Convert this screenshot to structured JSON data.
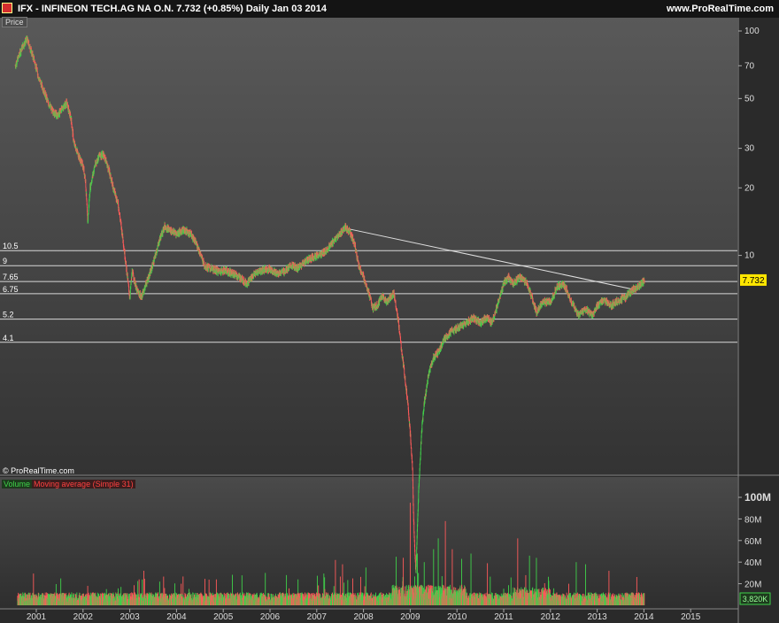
{
  "header": {
    "title": "IFX - INFINEON TECH.AG NA O.N.    7.732 (+0.85%)    Daily  Jan 03 2014",
    "site": "www.ProRealTime.com"
  },
  "price_panel_label": "Price",
  "copyright": "© ProRealTime.com",
  "volume_panel": {
    "legend_volume": "Volume",
    "legend_ma": "Moving average (Simple 31)"
  },
  "colors": {
    "up": "#3fd14a",
    "down": "#ff5a5a",
    "level_line": "#d8d8d8",
    "price_tag": "#ffe600"
  },
  "chart_data": [
    {
      "type": "line",
      "title": "IFX - INFINEON TECH.AG NA O.N.",
      "ylabel": "Price",
      "y_scale": "log",
      "ylim": [
        2.5,
        120
      ],
      "xlim": [
        2000.5,
        2015.6
      ],
      "x_ticks": [
        "2001",
        "2002",
        "2003",
        "2004",
        "2005",
        "2006",
        "2007",
        "2008",
        "2009",
        "2010",
        "2011",
        "2012",
        "2013",
        "2014",
        "2015"
      ],
      "y_ticks": [
        10,
        20,
        30,
        50,
        70,
        100
      ],
      "last_price": "7.732",
      "last_change": "+0.85%",
      "grid": false,
      "series": [
        {
          "values": [
            [
              2000.55,
              70
            ],
            [
              2000.7,
              85
            ],
            [
              2000.8,
              92
            ],
            [
              2000.95,
              75
            ],
            [
              2001.05,
              62
            ],
            [
              2001.15,
              55
            ],
            [
              2001.25,
              48
            ],
            [
              2001.35,
              44
            ],
            [
              2001.45,
              42
            ],
            [
              2001.55,
              45
            ],
            [
              2001.65,
              48
            ],
            [
              2001.75,
              40
            ],
            [
              2001.8,
              32
            ],
            [
              2001.9,
              28
            ],
            [
              2002.0,
              25
            ],
            [
              2002.05,
              22
            ],
            [
              2002.1,
              14
            ],
            [
              2002.15,
              20
            ],
            [
              2002.25,
              25
            ],
            [
              2002.35,
              28
            ],
            [
              2002.45,
              28
            ],
            [
              2002.55,
              24
            ],
            [
              2002.65,
              20
            ],
            [
              2002.75,
              17
            ],
            [
              2002.85,
              12
            ],
            [
              2002.95,
              8
            ],
            [
              2003.0,
              6.5
            ],
            [
              2003.05,
              8.5
            ],
            [
              2003.15,
              7
            ],
            [
              2003.25,
              6.5
            ],
            [
              2003.35,
              7.5
            ],
            [
              2003.45,
              8.5
            ],
            [
              2003.55,
              10
            ],
            [
              2003.65,
              12
            ],
            [
              2003.75,
              13.5
            ],
            [
              2003.85,
              13
            ],
            [
              2004.0,
              12.5
            ],
            [
              2004.15,
              13
            ],
            [
              2004.3,
              12.5
            ],
            [
              2004.45,
              11
            ],
            [
              2004.6,
              9
            ],
            [
              2004.75,
              8.7
            ],
            [
              2004.9,
              8.5
            ],
            [
              2005.05,
              8.6
            ],
            [
              2005.2,
              8.3
            ],
            [
              2005.35,
              8.0
            ],
            [
              2005.5,
              7.5
            ],
            [
              2005.65,
              8.2
            ],
            [
              2005.8,
              8.6
            ],
            [
              2006.0,
              8.7
            ],
            [
              2006.15,
              8.3
            ],
            [
              2006.3,
              8.5
            ],
            [
              2006.45,
              9.0
            ],
            [
              2006.6,
              8.8
            ],
            [
              2006.75,
              9.4
            ],
            [
              2006.9,
              9.8
            ],
            [
              2007.05,
              10
            ],
            [
              2007.2,
              10.5
            ],
            [
              2007.35,
              11.5
            ],
            [
              2007.5,
              12.5
            ],
            [
              2007.6,
              13.3
            ],
            [
              2007.7,
              12.8
            ],
            [
              2007.8,
              11.5
            ],
            [
              2007.9,
              9
            ],
            [
              2008.0,
              8
            ],
            [
              2008.1,
              7
            ],
            [
              2008.2,
              5.8
            ],
            [
              2008.3,
              6
            ],
            [
              2008.4,
              6.6
            ],
            [
              2008.5,
              6.2
            ],
            [
              2008.65,
              6.8
            ],
            [
              2008.75,
              5
            ],
            [
              2008.8,
              4
            ],
            [
              2008.85,
              3.3
            ],
            [
              2008.95,
              2.2
            ],
            [
              2009.0,
              1.6
            ],
            [
              2009.05,
              1.1
            ],
            [
              2009.08,
              0.6
            ],
            [
              2009.12,
              0.38
            ],
            [
              2009.18,
              0.9
            ],
            [
              2009.25,
              1.7
            ],
            [
              2009.3,
              2.2
            ],
            [
              2009.4,
              3.0
            ],
            [
              2009.5,
              3.5
            ],
            [
              2009.6,
              3.7
            ],
            [
              2009.75,
              4.3
            ],
            [
              2009.9,
              4.6
            ],
            [
              2010.05,
              4.8
            ],
            [
              2010.2,
              5.0
            ],
            [
              2010.35,
              5.3
            ],
            [
              2010.5,
              5.0
            ],
            [
              2010.65,
              5.3
            ],
            [
              2010.75,
              5.0
            ],
            [
              2010.9,
              6.3
            ],
            [
              2011.0,
              7.5
            ],
            [
              2011.1,
              8.0
            ],
            [
              2011.2,
              7.5
            ],
            [
              2011.35,
              8.0
            ],
            [
              2011.5,
              7.5
            ],
            [
              2011.6,
              6.5
            ],
            [
              2011.7,
              5.6
            ],
            [
              2011.85,
              6.2
            ],
            [
              2012.0,
              6.2
            ],
            [
              2012.15,
              7.3
            ],
            [
              2012.3,
              7.4
            ],
            [
              2012.45,
              6.2
            ],
            [
              2012.6,
              5.4
            ],
            [
              2012.75,
              5.8
            ],
            [
              2012.9,
              5.4
            ],
            [
              2013.0,
              6.0
            ],
            [
              2013.15,
              6.3
            ],
            [
              2013.3,
              6.0
            ],
            [
              2013.45,
              6.3
            ],
            [
              2013.6,
              6.5
            ],
            [
              2013.75,
              7.0
            ],
            [
              2013.85,
              7.2
            ],
            [
              2013.95,
              7.5
            ],
            [
              2014.01,
              7.732
            ]
          ]
        }
      ],
      "horizontal_levels": [
        {
          "label": "10.5",
          "value": 10.5
        },
        {
          "label": "9",
          "value": 9
        },
        {
          "label": "7.65",
          "value": 7.65
        },
        {
          "label": "6.75",
          "value": 6.75
        },
        {
          "label": "5.2",
          "value": 5.2
        },
        {
          "label": "4.1",
          "value": 4.1
        }
      ],
      "trendlines": [
        {
          "from": [
            2007.55,
            13.3
          ],
          "to": [
            2013.85,
            7.0
          ]
        }
      ]
    },
    {
      "type": "bar",
      "title": "Volume",
      "y_ticks": [
        "20M",
        "40M",
        "60M",
        "80M",
        "100M"
      ],
      "ylim": [
        0,
        105
      ],
      "unit": "M",
      "last_value": "3,820K",
      "spikes": [
        [
          2002.1,
          18
        ],
        [
          2002.5,
          15
        ],
        [
          2003.2,
          24
        ],
        [
          2003.3,
          32
        ],
        [
          2004.1,
          20
        ],
        [
          2004.85,
          24
        ],
        [
          2005.9,
          30
        ],
        [
          2006.35,
          28
        ],
        [
          2006.6,
          24
        ],
        [
          2007.4,
          42
        ],
        [
          2007.55,
          38
        ],
        [
          2008.05,
          35
        ],
        [
          2008.7,
          45
        ],
        [
          2008.85,
          44
        ],
        [
          2009.0,
          95
        ],
        [
          2009.15,
          48
        ],
        [
          2009.3,
          40
        ],
        [
          2009.5,
          52
        ],
        [
          2009.6,
          62
        ],
        [
          2009.75,
          78
        ],
        [
          2009.9,
          52
        ],
        [
          2010.1,
          43
        ],
        [
          2010.3,
          48
        ],
        [
          2010.65,
          39
        ],
        [
          2011.3,
          62
        ],
        [
          2011.55,
          46
        ],
        [
          2011.7,
          44
        ],
        [
          2012.55,
          40
        ],
        [
          2012.75,
          38
        ],
        [
          2013.25,
          32
        ]
      ]
    }
  ]
}
